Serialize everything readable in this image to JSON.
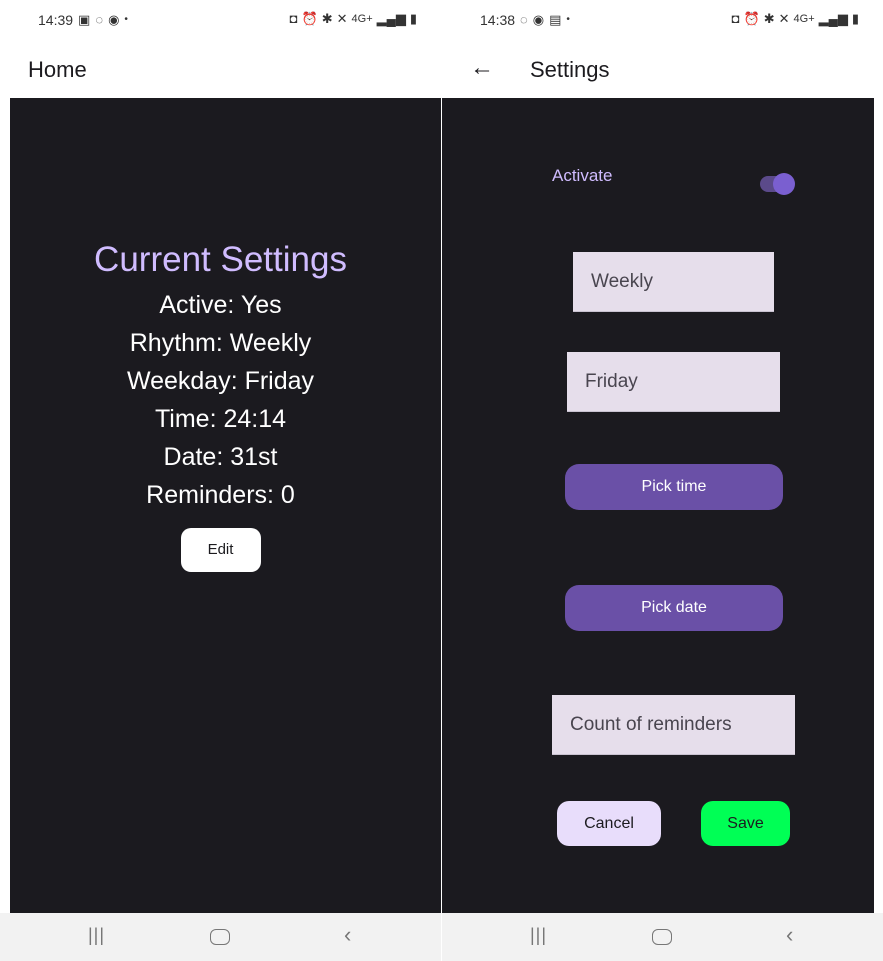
{
  "left": {
    "status": {
      "time": "14:39",
      "left_icons": [
        "gallery-icon",
        "whatsapp-icon",
        "app-icon"
      ],
      "right_icons": [
        "lock-icon",
        "alarm-icon",
        "bluetooth-icon",
        "mute-icon",
        "network-4g-icon",
        "signal-icon",
        "battery-icon"
      ],
      "network_label": "4G+"
    },
    "appbar": {
      "title": "Home"
    },
    "current_settings": {
      "heading": "Current Settings",
      "lines": [
        "Active: Yes",
        "Rhythm: Weekly",
        "Weekday: Friday",
        "Time: 24:14",
        "Date: 31st",
        "Reminders: 0"
      ],
      "edit_label": "Edit"
    }
  },
  "right": {
    "status": {
      "time": "14:38",
      "left_icons": [
        "whatsapp-icon",
        "app-icon",
        "message-icon"
      ],
      "right_icons": [
        "lock-icon",
        "alarm-icon",
        "bluetooth-icon",
        "mute-icon",
        "network-4g-icon",
        "signal-icon",
        "battery-icon"
      ],
      "network_label": "4G+"
    },
    "appbar": {
      "title": "Settings"
    },
    "settings": {
      "activate_label": "Activate",
      "activate_on": true,
      "rhythm_value": "Weekly",
      "weekday_value": "Friday",
      "pick_time_label": "Pick time",
      "pick_date_label": "Pick date",
      "count_placeholder": "Count of reminders",
      "cancel_label": "Cancel",
      "save_label": "Save"
    }
  },
  "colors": {
    "background_dark": "#1b1a1f",
    "accent_purple": "#6a50a7",
    "heading_lavender": "#d0bcff",
    "save_green": "#00ff55",
    "field_bg": "#e6deeb"
  }
}
